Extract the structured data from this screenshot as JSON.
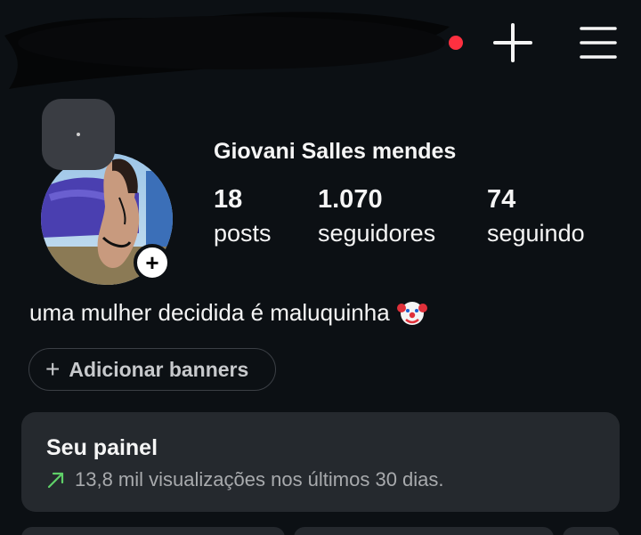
{
  "profile": {
    "display_name": "Giovani Salles mendes",
    "bio": "uma mulher decidida é maluquinha",
    "bio_emoji": "clown-face",
    "avatar_add_symbol": "+"
  },
  "stats": {
    "posts": {
      "value": "18",
      "label": "posts"
    },
    "followers": {
      "value": "1.070",
      "label": "seguidores"
    },
    "following": {
      "value": "74",
      "label": "seguindo"
    }
  },
  "actions": {
    "add_banners_label": "Adicionar banners",
    "add_banners_icon": "plus-icon"
  },
  "dashboard": {
    "title": "Seu painel",
    "summary": "13,8 mil visualizações nos últimos 30 dias.",
    "trend_icon": "trend-up-arrow-icon"
  },
  "colors": {
    "background": "#0c1014",
    "card": "#25292e",
    "notification_dot": "#ff3040",
    "trend": "#5fd068"
  }
}
